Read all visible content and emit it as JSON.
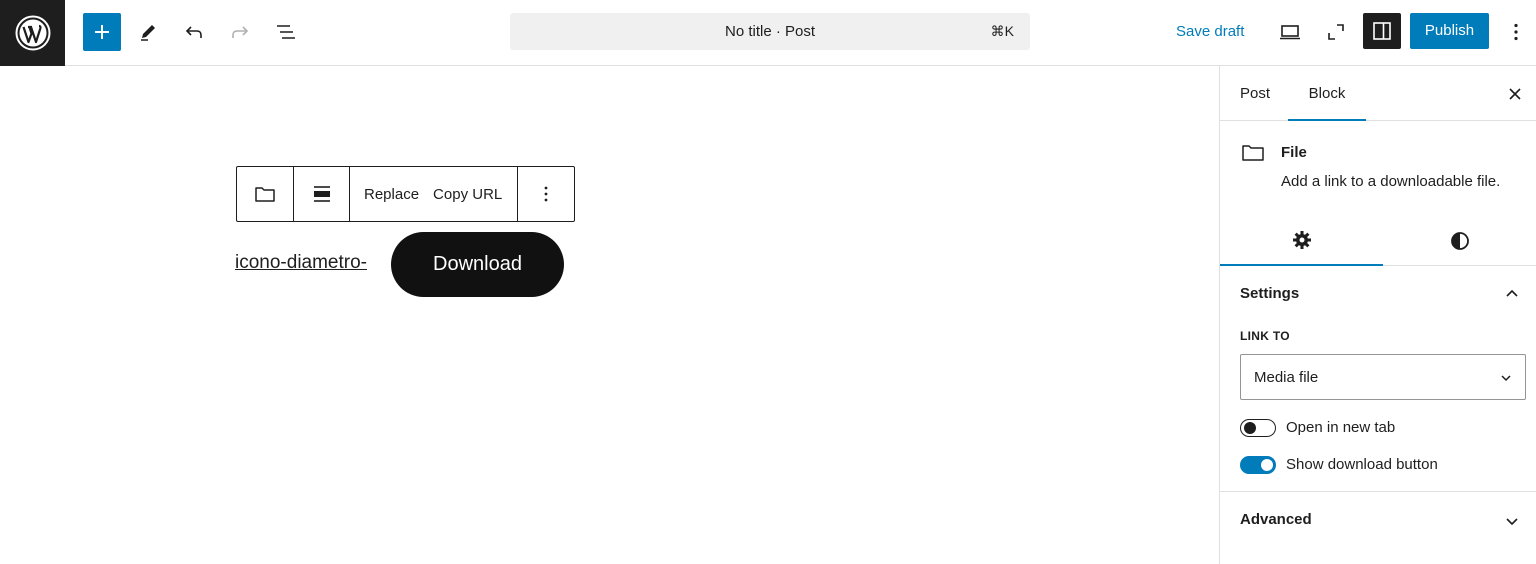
{
  "header": {
    "doc_title": "No title · Post",
    "shortcut": "⌘K",
    "save_draft": "Save draft",
    "publish": "Publish"
  },
  "block_toolbar": {
    "replace": "Replace",
    "copy_url": "Copy URL"
  },
  "file_block": {
    "file_name": "icono-diametro-",
    "download_label": "Download"
  },
  "sidebar": {
    "tabs": [
      {
        "label": "Post",
        "active": false
      },
      {
        "label": "Block",
        "active": true
      }
    ],
    "block_card": {
      "title": "File",
      "description": "Add a link to a downloadable file."
    },
    "settings": {
      "title": "Settings",
      "link_to_label": "LINK TO",
      "link_to_value": "Media file",
      "open_in_new_tab": {
        "label": "Open in new tab",
        "on": false
      },
      "show_download_button": {
        "label": "Show download button",
        "on": true
      }
    },
    "advanced": {
      "title": "Advanced"
    }
  },
  "colors": {
    "accent": "#007cba",
    "dark": "#1e1e1e",
    "download_bg": "#111111"
  }
}
